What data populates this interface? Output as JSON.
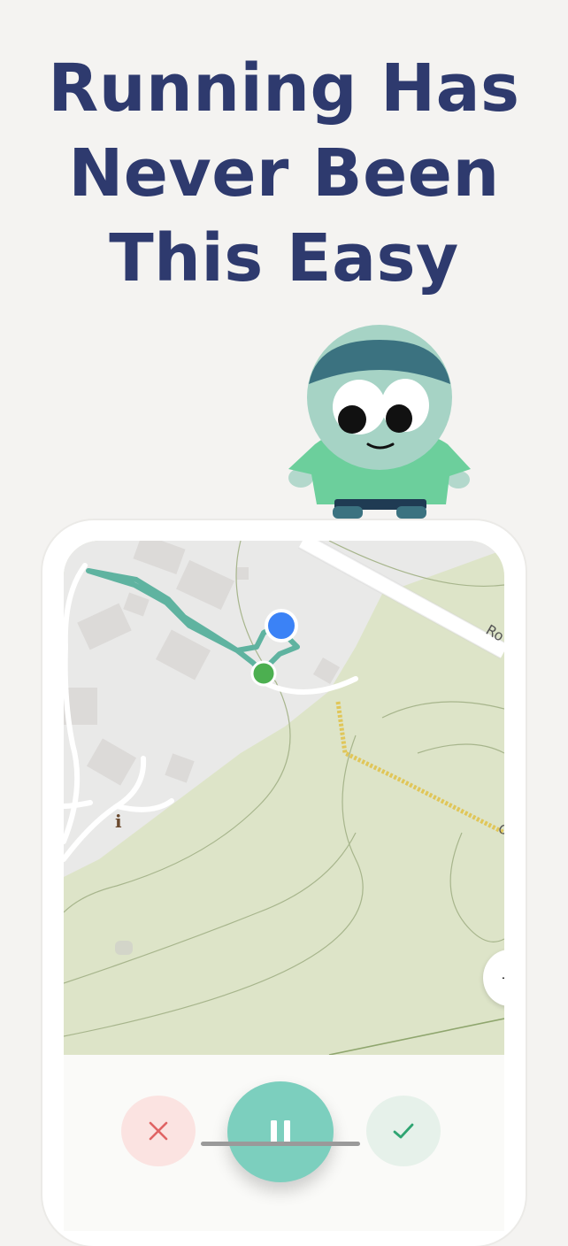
{
  "headline": {
    "line1": "Running Has",
    "line2": "Never Been",
    "line3": "This Easy"
  },
  "colors": {
    "headline": "#2e3a6e",
    "route": "#5fb3a0",
    "start_marker": "#4caf50",
    "current_location": "#3b82f6",
    "pause_button": "#7ccfbe",
    "cancel_button": "#fbe3e1",
    "done_button": "#e6f1ea"
  },
  "map": {
    "road_label_1": "Ro",
    "road_label_2": "O",
    "info_marker": "i",
    "zoom_label": "+"
  },
  "controls": {
    "cancel_icon": "close-icon",
    "pause_icon": "pause-icon",
    "done_icon": "check-icon"
  }
}
